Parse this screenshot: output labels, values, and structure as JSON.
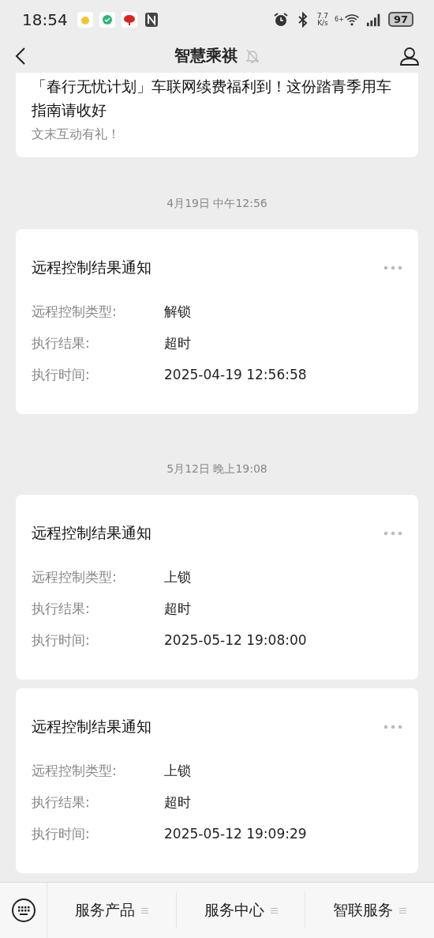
{
  "status_bar": {
    "time": "18:54",
    "speed_value": "7.7",
    "speed_unit": "K/s",
    "network": "6+",
    "battery": "97"
  },
  "nav": {
    "title": "智慧乘祺"
  },
  "top_message": {
    "title": "「春行无忧计划」车联网续费福利到！这份踏青季用车指南请收好",
    "subtitle": "文末互动有礼！"
  },
  "feed": [
    {
      "kind": "time",
      "text": "4月19日 中午12:56"
    },
    {
      "kind": "card",
      "title": "远程控制结果通知",
      "rows": [
        {
          "label": "远程控制类型:",
          "value": "解锁"
        },
        {
          "label": "执行结果:",
          "value": "超时"
        },
        {
          "label": "执行时间:",
          "value": "2025-04-19 12:56:58"
        }
      ]
    },
    {
      "kind": "time",
      "text": "5月12日 晚上19:08"
    },
    {
      "kind": "card",
      "title": "远程控制结果通知",
      "rows": [
        {
          "label": "远程控制类型:",
          "value": "上锁"
        },
        {
          "label": "执行结果:",
          "value": "超时"
        },
        {
          "label": "执行时间:",
          "value": "2025-05-12 19:08:00"
        }
      ]
    },
    {
      "kind": "card",
      "title": "远程控制结果通知",
      "rows": [
        {
          "label": "远程控制类型:",
          "value": "上锁"
        },
        {
          "label": "执行结果:",
          "value": "超时"
        },
        {
          "label": "执行时间:",
          "value": "2025-05-12 19:09:29"
        }
      ]
    }
  ],
  "menu": [
    {
      "label": "服务产品"
    },
    {
      "label": "服务中心"
    },
    {
      "label": "智联服务"
    }
  ]
}
